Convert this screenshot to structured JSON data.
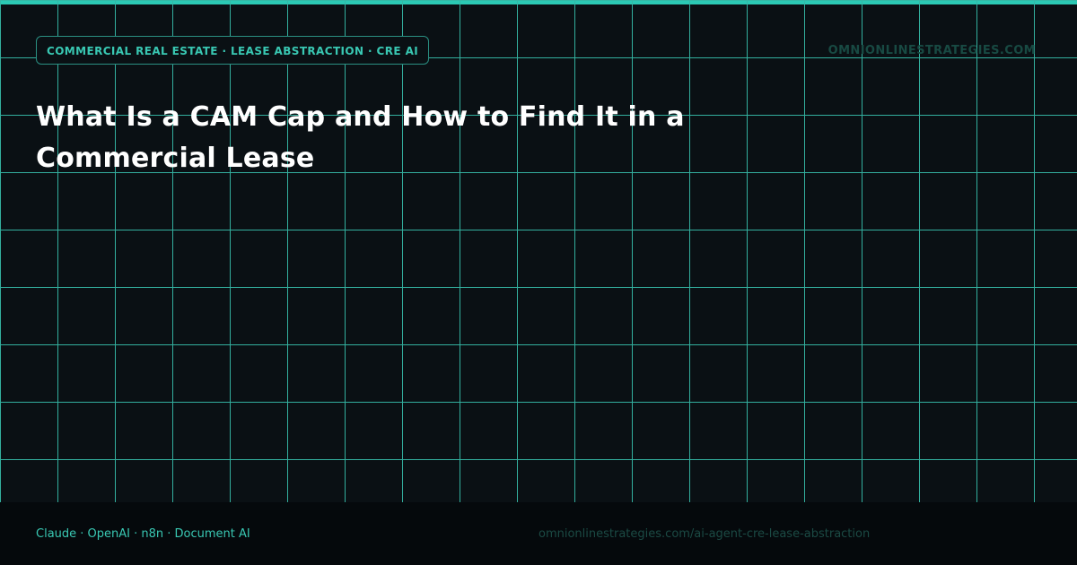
{
  "header": {
    "tag": "COMMERCIAL REAL ESTATE · LEASE ABSTRACTION · CRE AI",
    "brand": "OMNIONLINESTRATEGIES.COM"
  },
  "title": "What Is a CAM Cap and How to Find It in a Commercial Lease",
  "footer": {
    "stack": "Claude · OpenAI · n8n · Document AI",
    "url": "omnionlinestrategies.com/ai-agent-cre-lease-abstraction"
  },
  "colors": {
    "accent": "#2bc9b4",
    "background": "#0a1014",
    "footer_background": "#05090c",
    "grid_line": "#36b8a6",
    "title": "#ffffff",
    "muted": "#1b4a44"
  }
}
